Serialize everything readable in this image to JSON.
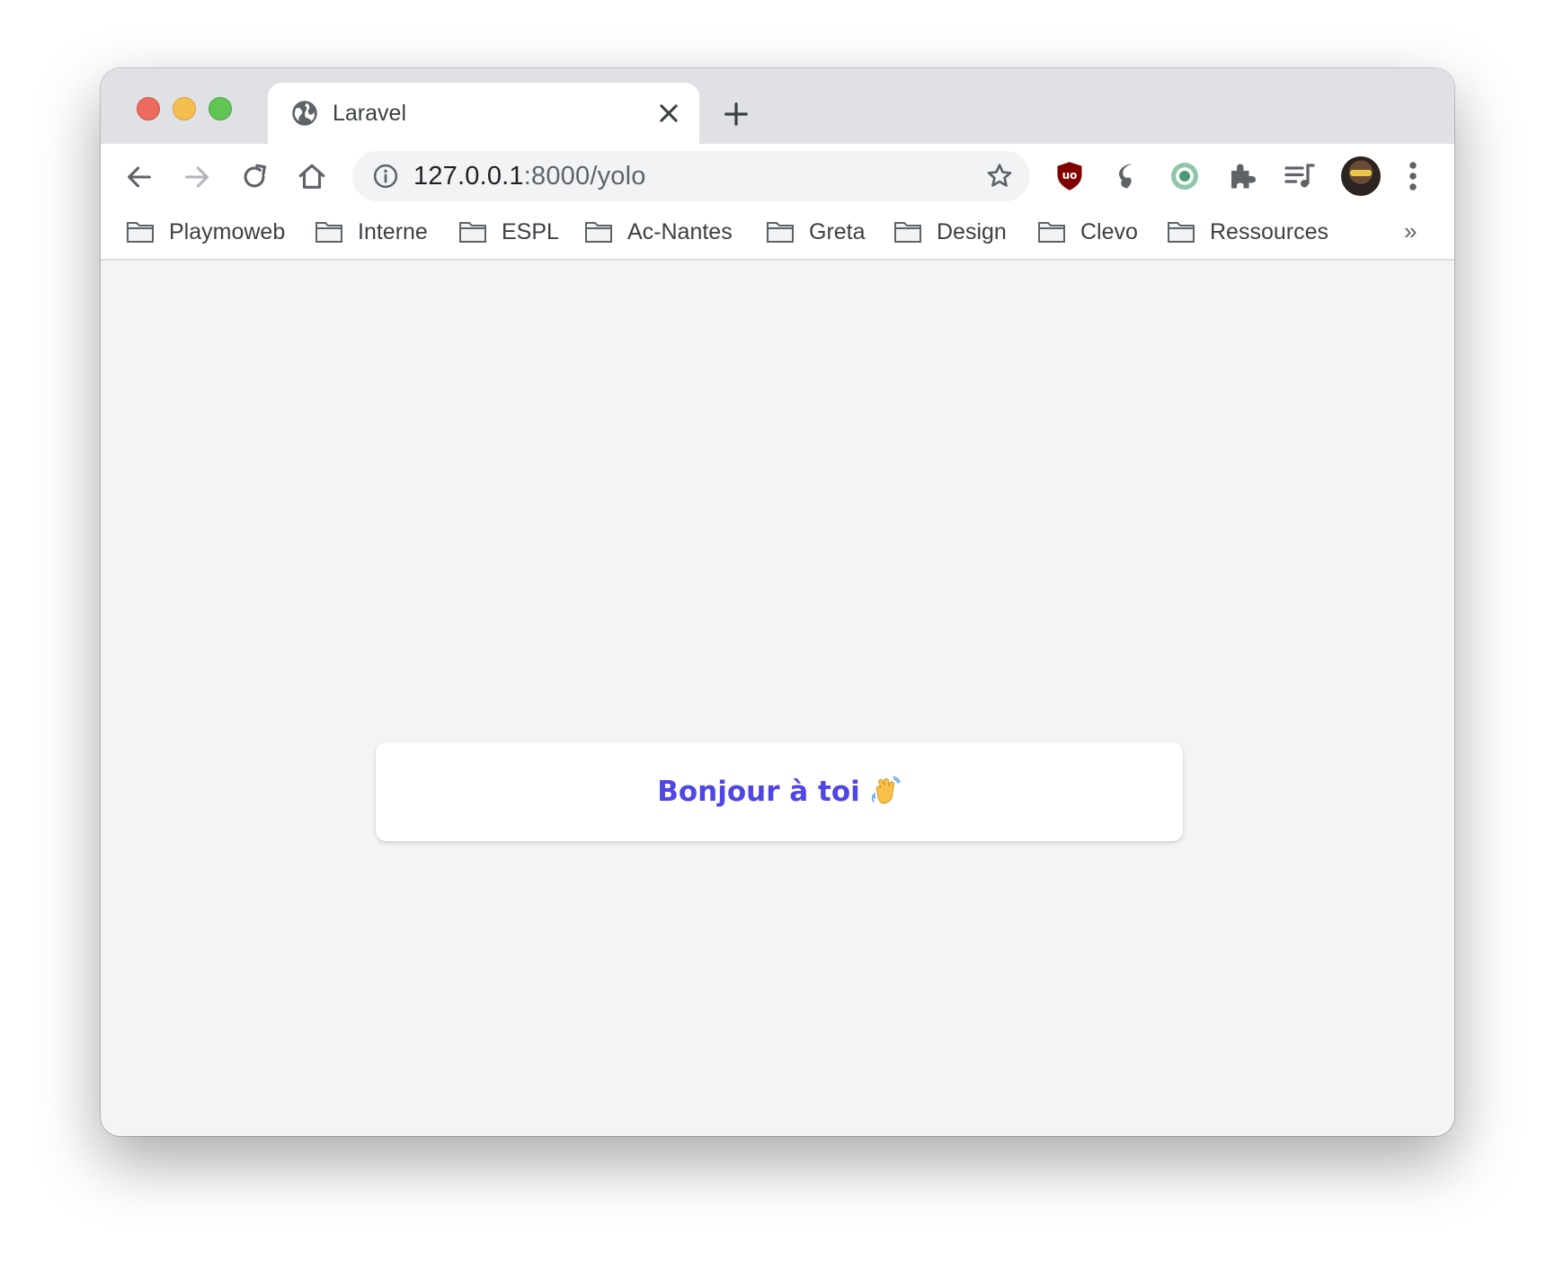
{
  "browser": {
    "tab": {
      "title": "Laravel",
      "favicon": "globe-icon",
      "close": "close-icon"
    },
    "new_tab": "plus-icon",
    "nav": {
      "back": "arrow-left-icon",
      "forward": "arrow-right-icon",
      "reload": "reload-icon",
      "home": "home-icon"
    },
    "omnibox": {
      "host": "127.0.0.1",
      "path": ":8000/yolo",
      "info_icon": "info-icon",
      "star_icon": "star-icon"
    },
    "extensions": [
      "ublock-icon",
      "extension-s-icon",
      "extension-ring-icon",
      "puzzle-icon",
      "media-queue-icon"
    ],
    "avatar": "avatar",
    "menu": "more-vert-icon",
    "bookmarks": [
      {
        "label": "Playmoweb"
      },
      {
        "label": "Interne"
      },
      {
        "label": "ESPL"
      },
      {
        "label": "Ac-Nantes"
      },
      {
        "label": "Greta"
      },
      {
        "label": "Design"
      },
      {
        "label": "Clevo"
      },
      {
        "label": "Ressources"
      }
    ],
    "bookmarks_overflow": "»"
  },
  "page": {
    "greeting": "Bonjour à toi",
    "greeting_emoji": "waving-hand-icon",
    "accent_color": "#4f46e5",
    "background_color": "#f3f4f6"
  }
}
